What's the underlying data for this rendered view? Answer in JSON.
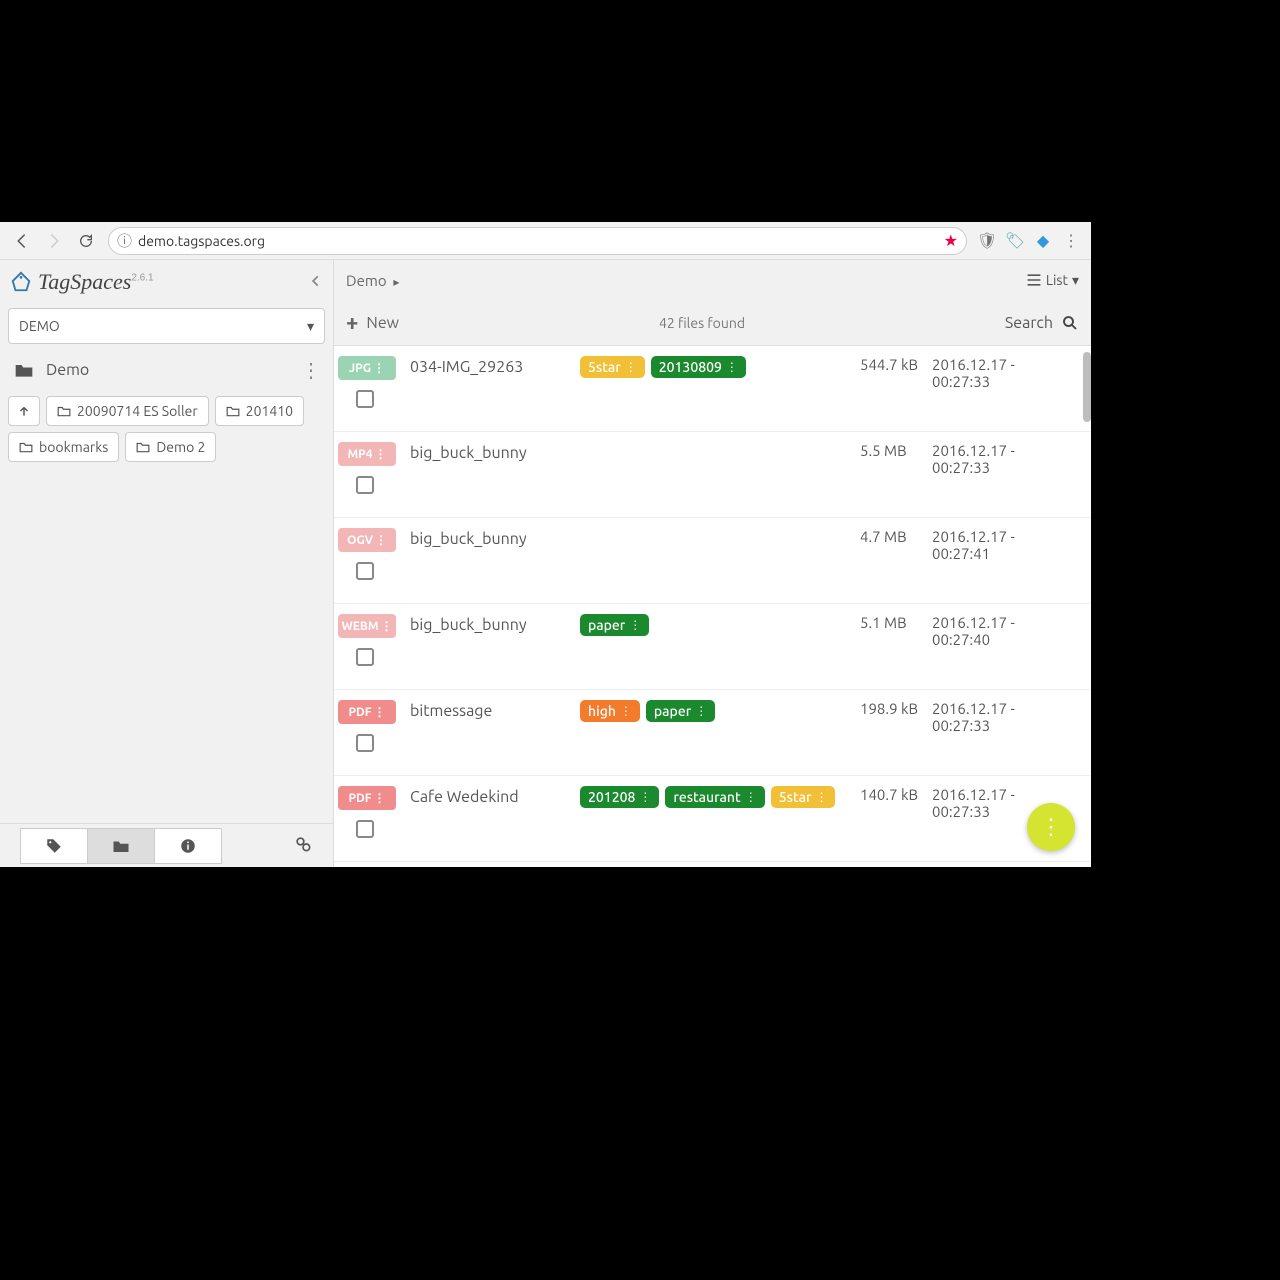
{
  "browser": {
    "url": "demo.tagspaces.org"
  },
  "app": {
    "name": "TagSpaces",
    "version": "2.6.1"
  },
  "location": {
    "selected": "DEMO",
    "current_name": "Demo"
  },
  "folders": {
    "items": [
      {
        "label": "20090714 ES Soller"
      },
      {
        "label": "201410"
      },
      {
        "label": "bookmarks"
      },
      {
        "label": "Demo 2"
      }
    ]
  },
  "breadcrumb": {
    "path": "Demo"
  },
  "view": {
    "label": "List"
  },
  "toolbar": {
    "new_label": "New",
    "files_found": "42 files found",
    "search_label": "Search"
  },
  "files": [
    {
      "ext": "JPG",
      "ext_class": "ext-jpg",
      "name": "034-IMG_29263",
      "tags": [
        {
          "label": "5star",
          "cls": "tg-yellow"
        },
        {
          "label": "20130809",
          "cls": "tg-green"
        }
      ],
      "size": "544.7 kB",
      "date": "2016.12.17 - 00:27:33"
    },
    {
      "ext": "MP4",
      "ext_class": "ext-mp4",
      "name": "big_buck_bunny",
      "tags": [],
      "size": "5.5 MB",
      "date": "2016.12.17 - 00:27:33"
    },
    {
      "ext": "OGV",
      "ext_class": "ext-ogv",
      "name": "big_buck_bunny",
      "tags": [],
      "size": "4.7 MB",
      "date": "2016.12.17 - 00:27:41"
    },
    {
      "ext": "WEBM",
      "ext_class": "ext-webm",
      "name": "big_buck_bunny",
      "tags": [
        {
          "label": "paper",
          "cls": "tg-green"
        }
      ],
      "size": "5.1 MB",
      "date": "2016.12.17 - 00:27:40"
    },
    {
      "ext": "PDF",
      "ext_class": "ext-pdf",
      "name": "bitmessage",
      "tags": [
        {
          "label": "high",
          "cls": "tg-orange"
        },
        {
          "label": "paper",
          "cls": "tg-green"
        }
      ],
      "size": "198.9 kB",
      "date": "2016.12.17 - 00:27:33"
    },
    {
      "ext": "PDF",
      "ext_class": "ext-pdf",
      "name": "Cafe Wedekind",
      "tags": [
        {
          "label": "201208",
          "cls": "tg-green"
        },
        {
          "label": "restaurant",
          "cls": "tg-green"
        },
        {
          "label": "5star",
          "cls": "tg-yellow"
        }
      ],
      "size": "140.7 kB",
      "date": "2016.12.17 - 00:27:33"
    }
  ]
}
